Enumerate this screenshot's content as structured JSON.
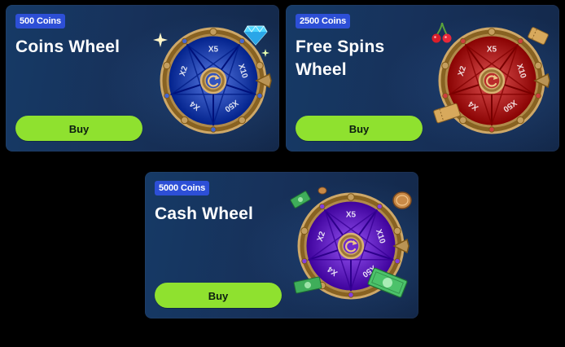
{
  "cards": [
    {
      "badge": "500 Coins",
      "title": "Coins Wheel",
      "button": "Buy",
      "wheel": {
        "color": "#1c3ea8",
        "labels": [
          "X5",
          "X10",
          "X50",
          "X4",
          "X2"
        ]
      }
    },
    {
      "badge": "2500 Coins",
      "title": "Free Spins Wheel",
      "button": "Buy",
      "wheel": {
        "color": "#a51616",
        "labels": [
          "X5",
          "X10",
          "X50",
          "X4",
          "X2"
        ]
      }
    },
    {
      "badge": "5000 Coins",
      "title": "Cash Wheel",
      "button": "Buy",
      "wheel": {
        "color": "#5a16b8",
        "labels": [
          "X5",
          "X10",
          "X50",
          "X4",
          "X2"
        ]
      }
    }
  ],
  "colors": {
    "card_bg": "#17315a",
    "badge_bg": "#2d4fd6",
    "button_bg": "#8fe12f",
    "wheel_rim": "#b08a4a"
  },
  "icons": [
    "diamond-icon",
    "sparkle-icon",
    "cherry-icon",
    "ticket-icon",
    "coin-icon",
    "cash-bill-icon"
  ]
}
